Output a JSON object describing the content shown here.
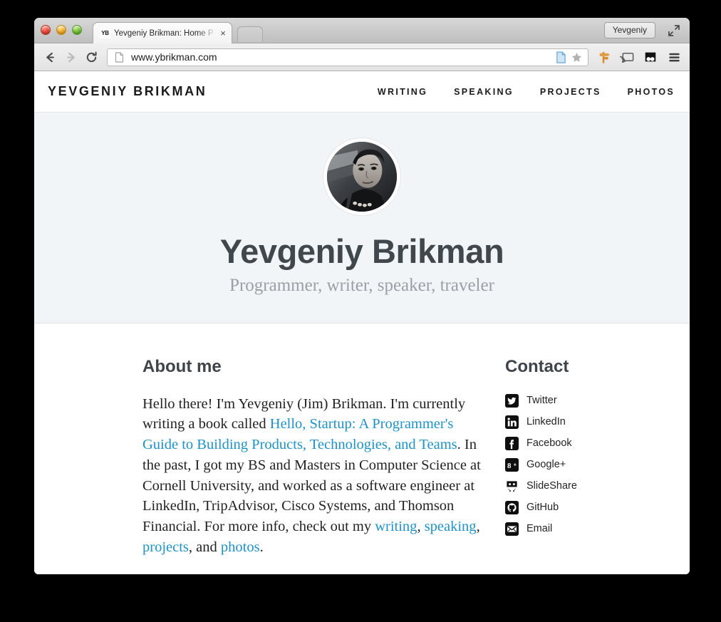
{
  "browser": {
    "tab": {
      "favicon_text": "YB",
      "title": "Yevgeniy Brikman: Home P",
      "close_label": "×"
    },
    "new_tab_name": "new-tab-button",
    "profile_label": "Yevgeniy",
    "toolbar": {
      "back_name": "back-button",
      "forward_name": "forward-button",
      "reload_name": "reload-button",
      "url": "www.ybrikman.com",
      "page_icon": "page-icon",
      "bookmark_icon": "star-icon",
      "extension_signpost": "signpost-extension-icon",
      "cast_icon": "cast-icon",
      "extension_panda": "panda-extension-icon",
      "menu_icon": "hamburger-menu-icon"
    }
  },
  "site": {
    "title": "YEVGENIY BRIKMAN",
    "nav": [
      {
        "label": "WRITING"
      },
      {
        "label": "SPEAKING"
      },
      {
        "label": "PROJECTS"
      },
      {
        "label": "PHOTOS"
      }
    ],
    "hero": {
      "avatar_name": "profile-avatar",
      "name": "Yevgeniy Brikman",
      "tagline": "Programmer, writer, speaker, traveler",
      "background_color": "#f2f5f8"
    },
    "about": {
      "heading": "About me",
      "p1_a": "Hello there! I'm Yevgeniy (Jim) Brikman. I'm currently writing a book called ",
      "p1_link": "Hello, Startup: A Programmer's Guide to Building Products, Technologies, and Teams",
      "p1_b": ". In the past, I got my BS and Masters in Computer Science at Cornell University, and worked as a software engineer at LinkedIn, TripAdvisor, Cisco Systems, and Thomson Financial. For more info, check out my ",
      "link_writing": "writing",
      "sep1": ", ",
      "link_speaking": "speaking",
      "sep2": ", ",
      "link_projects": "projects",
      "sep3": ", and ",
      "link_photos": "photos",
      "end": ".",
      "link_color": "#1b93cd"
    },
    "contact": {
      "heading": "Contact",
      "items": [
        {
          "label": "Twitter",
          "icon": "twitter-icon"
        },
        {
          "label": "LinkedIn",
          "icon": "linkedin-icon"
        },
        {
          "label": "Facebook",
          "icon": "facebook-icon"
        },
        {
          "label": "Google+",
          "icon": "googleplus-icon"
        },
        {
          "label": "SlideShare",
          "icon": "slideshare-icon"
        },
        {
          "label": "GitHub",
          "icon": "github-icon"
        },
        {
          "label": "Email",
          "icon": "email-icon"
        }
      ]
    }
  }
}
